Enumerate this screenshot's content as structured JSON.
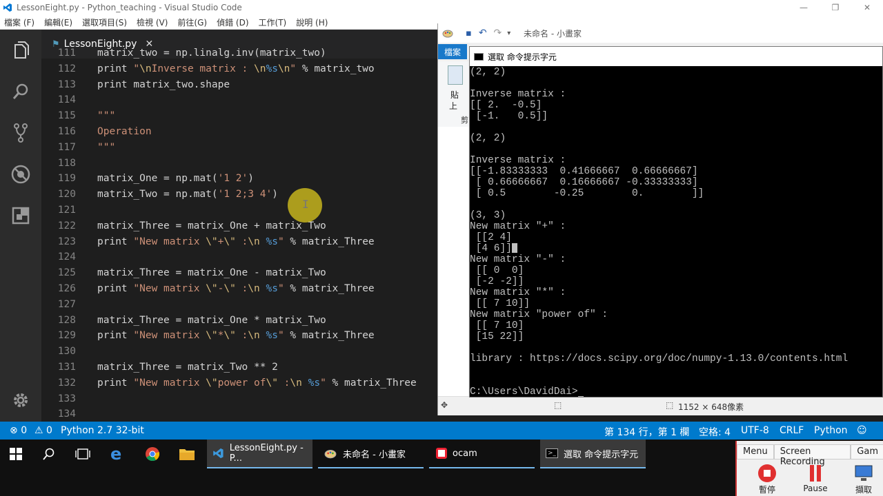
{
  "window": {
    "title": "LessonEight.py - Python_teaching - Visual Studio Code"
  },
  "menu": [
    "檔案 (F)",
    "編輯(E)",
    "選取項目(S)",
    "檢視 (V)",
    "前往(G)",
    "偵錯 (D)",
    "工作(T)",
    "說明 (H)"
  ],
  "editor": {
    "tab_label": "LessonEight.py",
    "lines": [
      {
        "num": "111",
        "code": "matrix_two = np.linalg.inv(matrix_two)"
      },
      {
        "num": "112",
        "code": "print \"\\nInverse matrix : \\n%s\\n\" % matrix_two"
      },
      {
        "num": "113",
        "code": "print matrix_two.shape"
      },
      {
        "num": "114",
        "code": ""
      },
      {
        "num": "115",
        "code": "\"\"\""
      },
      {
        "num": "116",
        "code": "Operation"
      },
      {
        "num": "117",
        "code": "\"\"\""
      },
      {
        "num": "118",
        "code": ""
      },
      {
        "num": "119",
        "code": "matrix_One = np.mat('1 2')"
      },
      {
        "num": "120",
        "code": "matrix_Two = np.mat('1 2;3 4')"
      },
      {
        "num": "121",
        "code": ""
      },
      {
        "num": "122",
        "code": "matrix_Three = matrix_One + matrix_Two"
      },
      {
        "num": "123",
        "code": "print \"New matrix \\\"+\\\" :\\n %s\" % matrix_Three"
      },
      {
        "num": "124",
        "code": ""
      },
      {
        "num": "125",
        "code": "matrix_Three = matrix_One - matrix_Two"
      },
      {
        "num": "126",
        "code": "print \"New matrix \\\"-\\\" :\\n %s\" % matrix_Three"
      },
      {
        "num": "127",
        "code": ""
      },
      {
        "num": "128",
        "code": "matrix_Three = matrix_One * matrix_Two"
      },
      {
        "num": "129",
        "code": "print \"New matrix \\\"*\\\" :\\n %s\" % matrix_Three"
      },
      {
        "num": "130",
        "code": ""
      },
      {
        "num": "131",
        "code": "matrix_Three = matrix_Two ** 2"
      },
      {
        "num": "132",
        "code": "print \"New matrix \\\"power of\\\" :\\n %s\" % matrix_Three"
      },
      {
        "num": "133",
        "code": ""
      },
      {
        "num": "134",
        "code": ""
      }
    ]
  },
  "statusbar": {
    "errors": "0",
    "warnings": "0",
    "interpreter": "Python 2.7 32-bit",
    "position": "第 134 行，第 1 欄",
    "indent": "空格: 4",
    "encoding": "UTF-8",
    "eol": "CRLF",
    "language": "Python"
  },
  "paint": {
    "title": "未命名 - 小畫家",
    "ribbon_tab": "檔案",
    "paste_label": "貼",
    "paste_label2": "上",
    "cut_label": "剪",
    "dimensions": "1152 × 648像素"
  },
  "cmd": {
    "title": "選取 命令提示字元",
    "lines": [
      "(2, 2)",
      "",
      "Inverse matrix :",
      "[[ 2.  -0.5]",
      " [-1.   0.5]]",
      "",
      "(2, 2)",
      "",
      "Inverse matrix :",
      "[[-1.83333333  0.41666667  0.66666667]",
      " [ 0.66666667  0.16666667 -0.33333333]",
      " [ 0.5        -0.25        0.        ]]",
      "",
      "(3, 3)",
      "New matrix \"+\" :",
      " [[2 4]",
      " [4 6]]",
      "New matrix \"-\" :",
      " [[ 0  0]",
      " [-2 -2]]",
      "New matrix \"*\" :",
      " [[ 7 10]]",
      "New matrix \"power of\" :",
      " [[ 7 10]",
      " [15 22]]",
      "",
      "library : https://docs.scipy.org/doc/numpy-1.13.0/contents.html",
      "",
      "",
      "C:\\Users\\DavidDai>"
    ]
  },
  "taskbar": {
    "apps": [
      {
        "label": "LessonEight.py - P..."
      },
      {
        "label": "未命名 - 小畫家"
      },
      {
        "label": "ocam"
      },
      {
        "label": "選取 命令提示字元"
      }
    ]
  },
  "ocam": {
    "tabs": [
      "Menu",
      "Screen Recording",
      "Gam"
    ],
    "stop_label": "暫停",
    "pause_label": "Pause",
    "capture_label": "擷取"
  },
  "colors": {
    "statusbar": "#007acc",
    "editor_bg": "#1e1e1e",
    "string": "#ce9178",
    "cursor_highlight": "#dcc81e"
  }
}
